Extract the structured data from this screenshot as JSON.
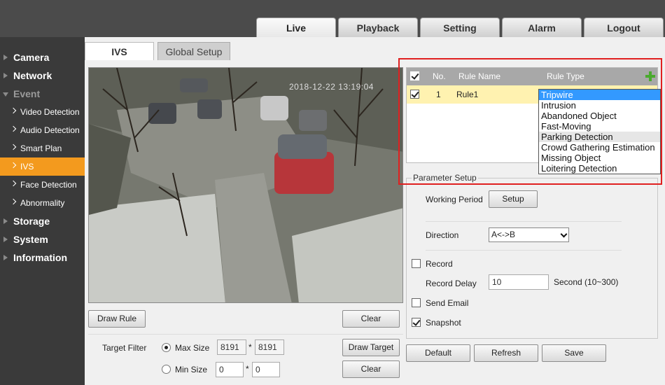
{
  "top_tabs": [
    "Live",
    "Playback",
    "Setting",
    "Alarm",
    "Logout"
  ],
  "sidebar": {
    "items": [
      {
        "label": "Camera"
      },
      {
        "label": "Network"
      },
      {
        "label": "Event"
      },
      {
        "label": "Video Detection"
      },
      {
        "label": "Audio Detection"
      },
      {
        "label": "Smart Plan"
      },
      {
        "label": "IVS"
      },
      {
        "label": "Face Detection"
      },
      {
        "label": "Abnormality"
      },
      {
        "label": "Storage"
      },
      {
        "label": "System"
      },
      {
        "label": "Information"
      }
    ]
  },
  "sub_tabs": {
    "ivs": "IVS",
    "global_setup": "Global Setup"
  },
  "video": {
    "timestamp": "2018-12-22 13:19:04"
  },
  "left_controls": {
    "draw_rule": "Draw Rule",
    "clear": "Clear",
    "target_filter": "Target Filter",
    "max_size": "Max Size",
    "min_size": "Min Size",
    "max_w": "8191",
    "max_h": "8191",
    "min_w": "0",
    "min_h": "0",
    "times": "*",
    "draw_target": "Draw Target",
    "clear2": "Clear"
  },
  "rule_table": {
    "headers": {
      "no": "No.",
      "name": "Rule Name",
      "type": "Rule Type"
    },
    "rows": [
      {
        "no": "1",
        "name": "Rule1",
        "checked": true
      }
    ]
  },
  "rule_type_options": [
    "Tripwire",
    "Intrusion",
    "Abandoned Object",
    "Fast-Moving",
    "Parking Detection",
    "Crowd Gathering Estimation",
    "Missing Object",
    "Loitering Detection"
  ],
  "params": {
    "legend": "Parameter Setup",
    "working_period": "Working Period",
    "setup": "Setup",
    "direction": "Direction",
    "direction_value": "A<->B",
    "record": "Record",
    "record_delay": "Record Delay",
    "record_delay_value": "10",
    "second_hint": "Second (10~300)",
    "send_email": "Send Email",
    "snapshot": "Snapshot"
  },
  "buttons": {
    "default": "Default",
    "refresh": "Refresh",
    "save": "Save"
  }
}
